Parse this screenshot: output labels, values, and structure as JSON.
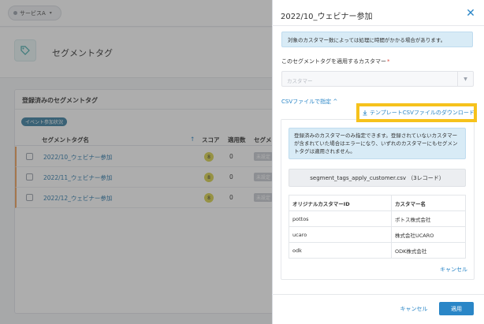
{
  "background": {
    "service_selector": "サービスA",
    "page_title": "セグメントタグ",
    "card_title": "登録済みのセグメントタグ",
    "event_chip": "イベント参加状況",
    "columns": {
      "name": "セグメントタグ名",
      "score": "スコア",
      "count": "適用数",
      "segment": "セグメ"
    },
    "rows": [
      {
        "name": "2022/10_ウェビナー参加",
        "score": "8",
        "count": "0",
        "segment": "未設定"
      },
      {
        "name": "2022/11_ウェビナー参加",
        "score": "8",
        "count": "0",
        "segment": "未設定"
      },
      {
        "name": "2022/12_ウェビナー参加",
        "score": "8",
        "count": "0",
        "segment": "未設定"
      }
    ]
  },
  "panel": {
    "title": "2022/10_ウェビナー参加",
    "info": "対象のカスタマー数によっては処理に時間がかかる場合があります。",
    "field_label": "このセグメントタグを適用するカスタマー",
    "required_mark": "*",
    "select_placeholder": "カスタマー",
    "csv_toggle": "CSVファイルで指定 ^",
    "download_link": "テンプレートCSVファイルのダウンロード",
    "notice": "登録済みのカスタマーのみ指定できます。登録されていないカスタマーが含まれていた場合はエラーになり、いずれのカスタマーにもセグメントタグは適用されません。",
    "file_name": "segment_tags_apply_customer.csv （3レコード）",
    "table": {
      "headers": [
        "オリジナルカスタマーID",
        "カスタマー名"
      ],
      "rows": [
        [
          "pottos",
          "ポトス株式会社"
        ],
        [
          "ucaro",
          "株式会社UCARO"
        ],
        [
          "odk",
          "ODK株式会社"
        ]
      ]
    },
    "inner_cancel": "キャンセル",
    "footer_cancel": "キャンセル",
    "footer_apply": "適用"
  },
  "colors": {
    "accent": "#2a86c7",
    "highlight": "#f6c21c",
    "info_bg": "#d8ebf6"
  }
}
